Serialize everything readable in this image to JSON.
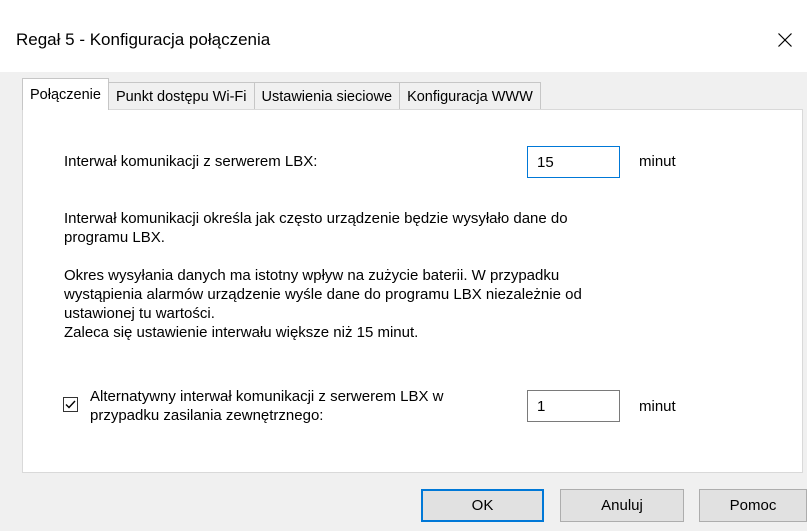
{
  "window": {
    "title": "Regał 5 - Konfiguracja połączenia",
    "close_glyph": "✕"
  },
  "tabs": [
    {
      "label": "Połączenie",
      "active": true
    },
    {
      "label": "Punkt dostępu Wi-Fi",
      "active": false
    },
    {
      "label": "Ustawienia sieciowe",
      "active": false
    },
    {
      "label": "Konfiguracja WWW",
      "active": false
    }
  ],
  "connection": {
    "interval_label": "Interwał komunikacji z serwerem LBX:",
    "interval_value": "15",
    "interval_unit": "minut",
    "description": {
      "line1": "Interwał komunikacji określa jak często urządzenie będzie wysyłało dane do",
      "line2": "programu LBX."
    },
    "battery_note": {
      "line1": "Okres wysyłania danych ma istotny wpływ na zużycie baterii. W przypadku",
      "line2": "wystąpienia alarmów urządzenie wyśle dane do programu LBX niezależnie od",
      "line3": "ustawionej tu wartości.",
      "line4": "Zaleca się ustawienie interwału większe niż 15 minut."
    },
    "alt_interval": {
      "checked": true,
      "label_line1": "Alternatywny interwał komunikacji z serwerem LBX w",
      "label_line2": "przypadku zasilania zewnętrznego:",
      "value": "1",
      "unit": "minut"
    }
  },
  "buttons": {
    "ok": "OK",
    "cancel": "Anuluj",
    "help": "Pomoc"
  },
  "colors": {
    "focus_accent": "#0078d7",
    "dialog_background": "#f0f0f0",
    "panel_background": "#ffffff"
  }
}
